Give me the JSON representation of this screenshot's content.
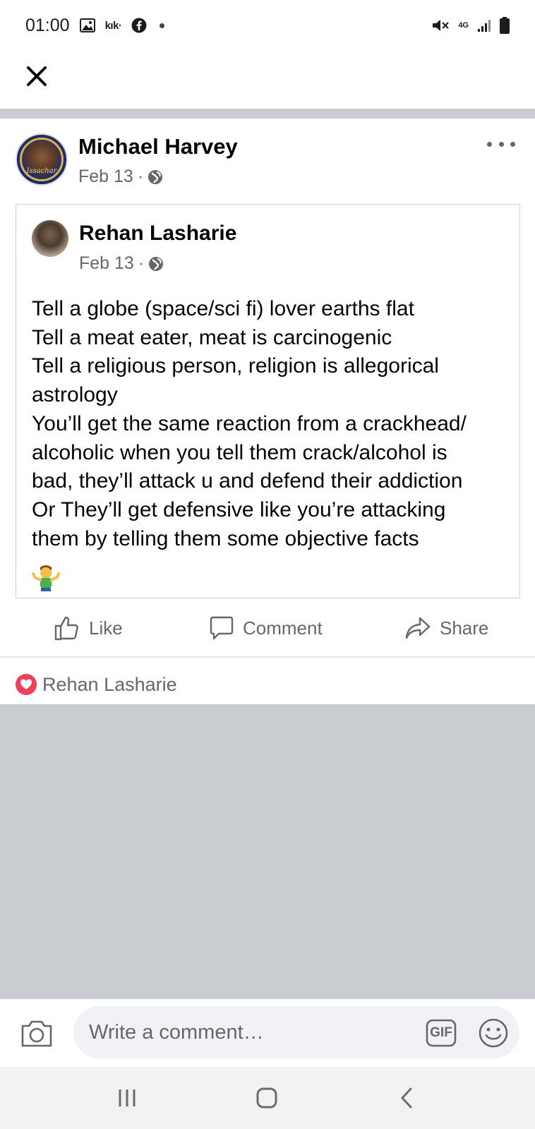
{
  "status_bar": {
    "time": "01:00",
    "kik_label": "kık·",
    "network_label": "4G",
    "icons_left": [
      "gallery-icon",
      "kik-icon",
      "facebook-icon",
      "notification-dot"
    ],
    "icons_right": [
      "vibrate-icon",
      "network-4g-icon",
      "signal-icon",
      "battery-icon"
    ]
  },
  "header": {
    "close_icon": "close-icon"
  },
  "post": {
    "author": "Michael Harvey",
    "avatar_caption": "Issachar",
    "date": "Feb 13",
    "audience_icon": "globe-icon",
    "more_icon": "more-options-icon"
  },
  "shared_post": {
    "author": "Rehan Lasharie",
    "date": "Feb 13",
    "audience_icon": "globe-icon",
    "body_lines": [
      "Tell a globe (space/sci fi) lover earths flat",
      "Tell a meat eater, meat is carcinogenic",
      "Tell a religious person, religion is allegorical",
      "astrology",
      "You’ll get the same reaction from a crackhead/",
      "alcoholic when you tell them crack/alcohol is",
      "bad, they’ll attack u and defend their addiction",
      "Or They’ll get defensive like you’re attacking",
      "them by telling them some objective facts"
    ],
    "emoji": "person-shrugging-emoji"
  },
  "actions": {
    "like": "Like",
    "comment": "Comment",
    "share": "Share"
  },
  "reactions": {
    "icon": "love-reaction-icon",
    "names": "Rehan Lasharie"
  },
  "composer": {
    "placeholder": "Write a comment…",
    "camera_icon": "camera-icon",
    "gif_label": "GIF",
    "emoji_icon": "emoji-icon"
  },
  "nav_bar": {
    "recents_icon": "recents-icon",
    "home_icon": "home-icon",
    "back_icon": "back-icon"
  },
  "colors": {
    "primary_text": "#050505",
    "secondary_text": "#65676b",
    "divider": "#c9ccd1",
    "love": "#f33e58",
    "composer_bg": "#f0f2f5"
  }
}
